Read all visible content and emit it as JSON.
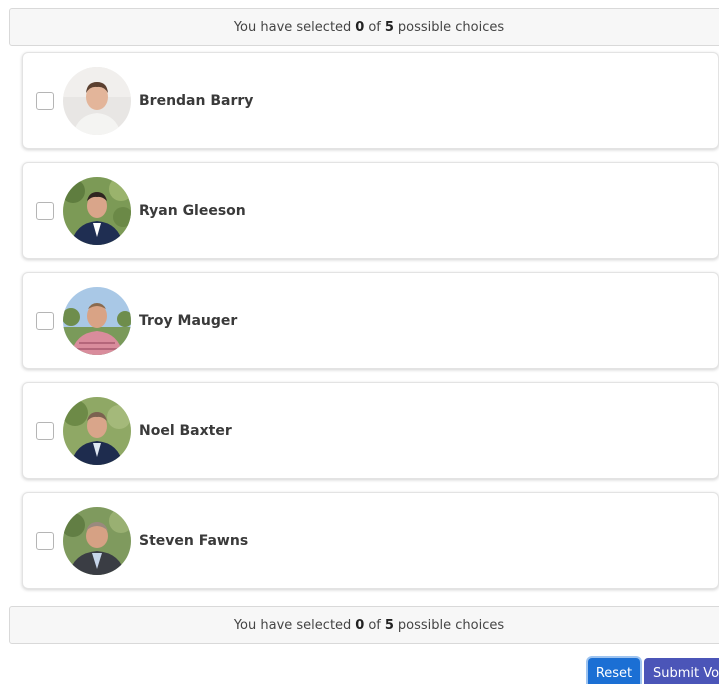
{
  "status": {
    "prefix": "You have selected",
    "selected": "0",
    "middle": "of",
    "total": "5",
    "suffix": "possible choices"
  },
  "candidates": [
    {
      "name": "Brendan Barry"
    },
    {
      "name": "Ryan Gleeson"
    },
    {
      "name": "Troy Mauger"
    },
    {
      "name": "Noel Baxter"
    },
    {
      "name": "Steven Fawns"
    }
  ],
  "buttons": {
    "reset": "Reset",
    "submit": "Submit Vote"
  },
  "colors": {
    "reset_button": "#1b6fd4",
    "submit_button": "#4b55b8",
    "status_background": "#f7f7f7"
  }
}
